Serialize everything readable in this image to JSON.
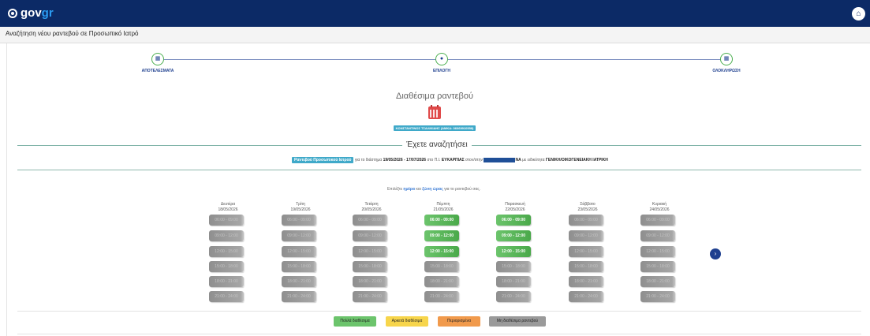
{
  "header": {
    "logo_main": "gov",
    "logo_accent": "gr",
    "home_icon": "home-icon"
  },
  "page": {
    "subtitle": "Αναζήτηση νέου ραντεβού σε Προσωπικό Ιατρό"
  },
  "steps": [
    {
      "label": "ΑΠΟΤΕΛΕΣΜΑΤΑ",
      "icon": "list-icon"
    },
    {
      "label": "ΕΠΙΛΟΓΗ",
      "icon": "select-icon"
    },
    {
      "label": "ΟΛΟΚΛΗΡΩΣΗ",
      "icon": "check-icon"
    }
  ],
  "available": {
    "title": "Διαθέσιμα ραντεβού",
    "doctor": "ΚΩΝΣΤΑΝΤΙΝΟΣ ΤΣΑΛΙΚΙΔΗΣ (ΑΜΚΑ: 06069910558)"
  },
  "search": {
    "title": "Έχετε αναζητήσει",
    "tag": "Ραντεβού Προσωπικού Ιατρού",
    "pre": "για το διάστημα",
    "range": "19/05/2026 - 17/07/2026",
    "at": "στο Π.Ι.",
    "place": "ΕΥΚΑΡΠΙΑΣ",
    "mid": "στον/στην",
    "name_end": "ΝΑ",
    "spec_pre": "με ειδικότητα",
    "specialty": "ΓΕΝΙΚΗ/ΟΙΚΟΓΕΝΕΙΑΚΗ ΙΑΤΡΙΚΗ"
  },
  "hint": {
    "pre": "Επιλέξτε",
    "day": "ημέρα",
    "and": "και",
    "zone": "ζώνη ώρας",
    "post": "για το ραντεβού σας."
  },
  "days": [
    {
      "name": "Δευτέρα",
      "date": "18/05/2026"
    },
    {
      "name": "Τρίτη",
      "date": "19/05/2026"
    },
    {
      "name": "Τετάρτη",
      "date": "20/05/2026"
    },
    {
      "name": "Πέμπτη",
      "date": "21/05/2026"
    },
    {
      "name": "Παρασκευή",
      "date": "22/05/2026"
    },
    {
      "name": "Σάββατο",
      "date": "23/05/2026"
    },
    {
      "name": "Κυριακή",
      "date": "24/05/2026"
    }
  ],
  "time_slots": [
    "06:00 - 09:00",
    "09:00 - 12:00",
    "12:00 - 15:00",
    "15:00 - 18:00",
    "18:00 - 21:00",
    "21:00 - 24:00"
  ],
  "availability": [
    [
      "none",
      "none",
      "none",
      "none",
      "none",
      "none"
    ],
    [
      "none",
      "none",
      "none",
      "none",
      "none",
      "none"
    ],
    [
      "none",
      "none",
      "none",
      "none",
      "none",
      "none"
    ],
    [
      "many",
      "many",
      "many",
      "none",
      "none",
      "none"
    ],
    [
      "many",
      "many",
      "many",
      "none",
      "none",
      "none"
    ],
    [
      "none",
      "none",
      "none",
      "none",
      "none",
      "none"
    ],
    [
      "none",
      "none",
      "none",
      "none",
      "none",
      "none"
    ]
  ],
  "legend": [
    {
      "label": "Πολλά διαθέσιμα",
      "color": "#6cc46c"
    },
    {
      "label": "Αρκετά διαθέσιμα",
      "color": "#f7d54b"
    },
    {
      "label": "Περιορισμένα",
      "color": "#f19a4c"
    },
    {
      "label": "Μη διαθέσιμα ραντεβού",
      "color": "#9a9a9a"
    }
  ],
  "nav": {
    "next_icon": "chevron-right-icon"
  }
}
